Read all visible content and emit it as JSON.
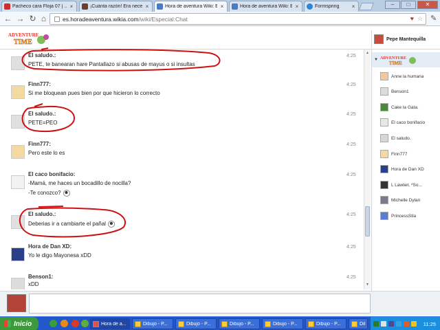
{
  "browser": {
    "tabs": [
      {
        "title": "Pacheco cara Floja 07 | ...",
        "color": "#d22c2c"
      },
      {
        "title": "¡Cuánta razón! Era nece...",
        "color": "#6b3f2b"
      },
      {
        "title": "Hora de aventura Wiki: E...",
        "color": "#4a7bc9"
      },
      {
        "title": "Hora de aventura Wiki: E...",
        "color": "#4a7bc9"
      },
      {
        "title": "Formspring",
        "color": "#2c86d4"
      }
    ],
    "active_tab": 2,
    "url_host": "es.horadeaventura.wikia.com",
    "url_path": "/wiki/Especial:Chat",
    "window_controls": {
      "minimize": "–",
      "maximize": "□",
      "close": "✕"
    }
  },
  "chat": {
    "current_user": "Pepe Mantequilla",
    "messages": [
      {
        "sender": "El saludo.:",
        "lines": [
          "PETE, te banearan hare Pantallazo si abusas de mayus o si insultas"
        ],
        "time": "4:25"
      },
      {
        "sender": "Finn777:",
        "lines": [
          "Si me bloquean pues bien por que hicieron lo correcto"
        ],
        "time": "4:25"
      },
      {
        "sender": "El saludo.:",
        "lines": [
          "PETE=PEO"
        ],
        "time": "4:25"
      },
      {
        "sender": "Finn777:",
        "lines": [
          "Pero este lo es"
        ],
        "time": "4:25"
      },
      {
        "sender": "El caco bonifacio:",
        "lines": [
          "-Mamá, me haces un bocadillo de nocilla?",
          "-Te conozco?"
        ],
        "time": "4:25"
      },
      {
        "sender": "El saludo.:",
        "lines": [
          "Deberias ir a cambiarte el pañal"
        ],
        "time": "4:25"
      },
      {
        "sender": "Hora de Dan XD:",
        "lines": [
          "Yo le digo Mayonesa xDD"
        ],
        "time": "4:25"
      },
      {
        "sender": "Benson1:",
        "lines": [
          "xDD"
        ],
        "time": "4:25"
      }
    ],
    "users": [
      {
        "name": "Anne la humana",
        "color": "#f0c9a0"
      },
      {
        "name": "Benson1",
        "color": "#dcdcdc"
      },
      {
        "name": "Cake la Gata.",
        "color": "#4a8a3a"
      },
      {
        "name": "El caco bonifacio",
        "color": "#e8e8e8"
      },
      {
        "name": "El saludo.",
        "color": "#d8d8d8"
      },
      {
        "name": "Finn777",
        "color": "#f4d9a0"
      },
      {
        "name": "Hora de Dan XD",
        "color": "#2a3e8a"
      },
      {
        "name": "L Lawliet. *So...",
        "color": "#333333"
      },
      {
        "name": "Michelle Dylan",
        "color": "#7a7a8a"
      },
      {
        "name": "PrincessStla",
        "color": "#5c7bd6"
      }
    ]
  },
  "taskbar": {
    "start_label": "Inicio",
    "items": [
      {
        "label": "Hora de a..."
      },
      {
        "label": "Dibujo - P..."
      },
      {
        "label": "Dibujo - P..."
      },
      {
        "label": "Dibujo - P..."
      },
      {
        "label": "Dibujo - P..."
      },
      {
        "label": "Dibujo - P..."
      },
      {
        "label": "Dibujo - P..."
      }
    ],
    "clock": "11:25"
  },
  "colors": {
    "annotation": "#cc1111",
    "taskbar": "#2356c9",
    "start": "#3c9a3a"
  }
}
